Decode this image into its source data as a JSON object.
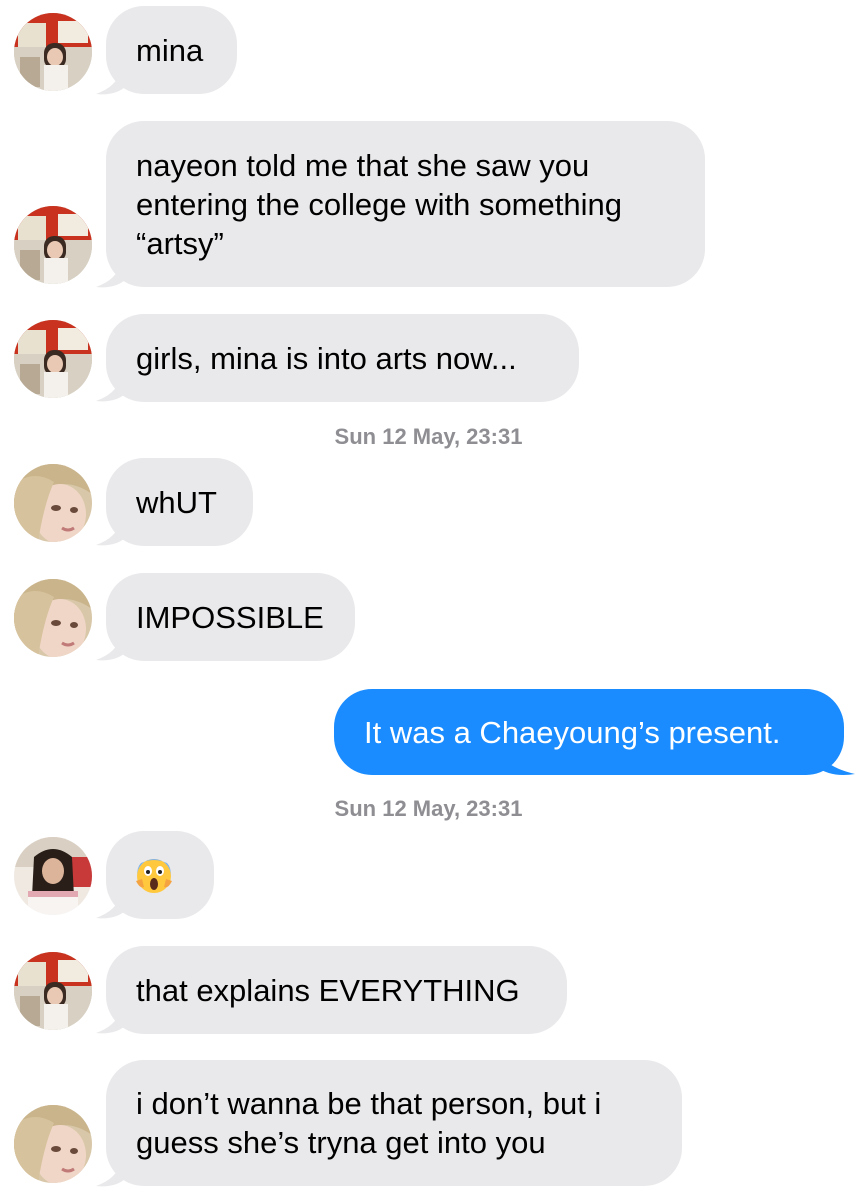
{
  "conversation": {
    "messages": [
      {
        "sender": "red-room-contact",
        "direction": "received",
        "lines": [
          "mina"
        ]
      },
      {
        "sender": "red-room-contact",
        "direction": "received",
        "lines": [
          "nayeon told me that she saw you",
          "entering the college with something",
          "“artsy”"
        ]
      },
      {
        "sender": "red-room-contact",
        "direction": "received",
        "lines": [
          "girls, mina is into arts now..."
        ]
      },
      {
        "sender": "blonde-contact",
        "direction": "received",
        "lines": [
          "whUT"
        ]
      },
      {
        "sender": "blonde-contact",
        "direction": "received",
        "lines": [
          "IMPOSSIBLE"
        ]
      },
      {
        "sender": "me",
        "direction": "sent",
        "lines": [
          "It was a Chaeyoung’s present."
        ]
      },
      {
        "sender": "dark-hair-contact",
        "direction": "received",
        "emoji": "face-screaming-in-fear"
      },
      {
        "sender": "red-room-contact",
        "direction": "received",
        "lines": [
          "that explains EVERYTHING"
        ]
      },
      {
        "sender": "blonde-contact",
        "direction": "received",
        "lines": [
          "i don’t wanna be that person, but i",
          "guess she’s tryna get into you"
        ]
      }
    ],
    "timestamps": [
      "Sun 12 May, 23:31",
      "Sun 12 May, 23:31"
    ]
  },
  "colors": {
    "received_bubble": "#e9e9eb",
    "sent_bubble": "#1a8cff",
    "timestamp_text": "#8e8e93",
    "background": "#ffffff"
  }
}
